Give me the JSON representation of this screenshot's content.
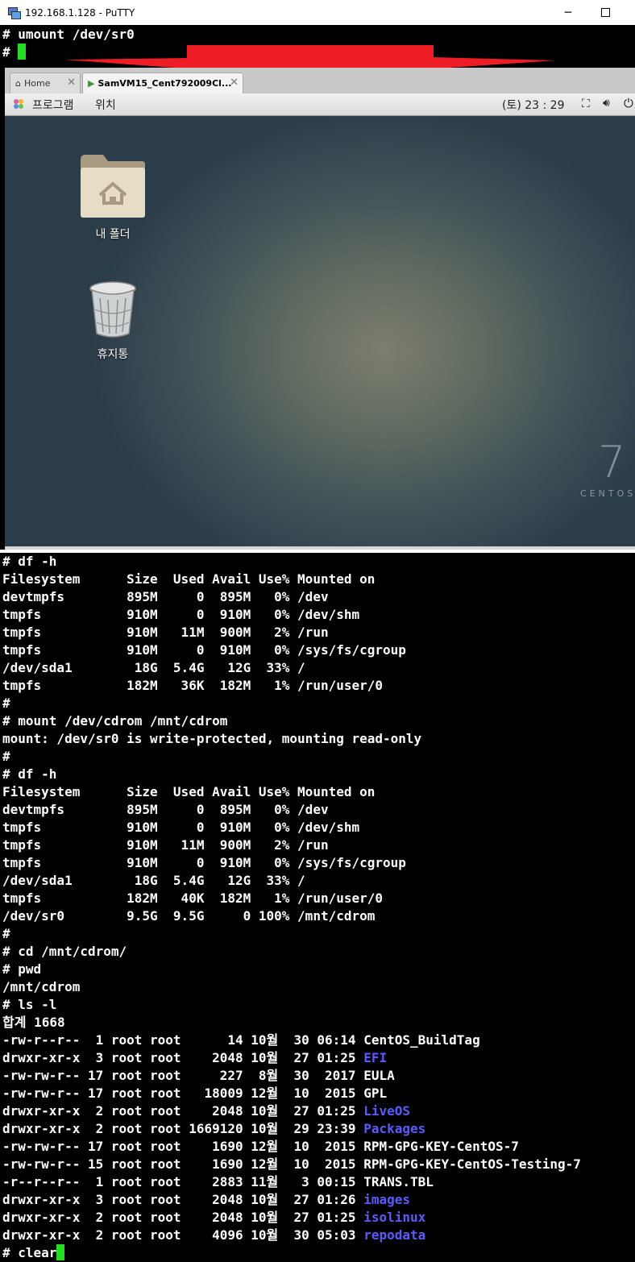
{
  "window": {
    "title": "192.168.1.128 - PuTTY",
    "minimize_glyph": "─"
  },
  "top_terminal": [
    {
      "text": "# umount /dev/sr0",
      "cursor": false
    },
    {
      "text": "# ",
      "cursor": true
    }
  ],
  "vm": {
    "tabs": [
      {
        "label": "Home",
        "icon": "home-icon",
        "active": false
      },
      {
        "label": "SamVM15_Cent792009Cl...",
        "icon": "vm-play-icon",
        "active": true
      }
    ],
    "close_glyph": "✕",
    "menu": {
      "applications": "프로그램",
      "places": "위치"
    },
    "clock": "(토) 23 : 29",
    "tray_icons": [
      "network-icon",
      "volume-icon",
      "power-icon"
    ],
    "desktop": {
      "icons": [
        {
          "label": "내 폴더",
          "icon": "home-folder-icon"
        },
        {
          "label": "휴지통",
          "icon": "trash-icon"
        }
      ],
      "watermark_number": "7",
      "watermark_text": "CENTOS"
    }
  },
  "bottom_terminal": [
    {
      "text": "# df -h"
    },
    {
      "text": "Filesystem      Size  Used Avail Use% Mounted on"
    },
    {
      "text": "devtmpfs        895M     0  895M   0% /dev"
    },
    {
      "text": "tmpfs           910M     0  910M   0% /dev/shm"
    },
    {
      "text": "tmpfs           910M   11M  900M   2% /run"
    },
    {
      "text": "tmpfs           910M     0  910M   0% /sys/fs/cgroup"
    },
    {
      "text": "/dev/sda1        18G  5.4G   12G  33% /"
    },
    {
      "text": "tmpfs           182M   36K  182M   1% /run/user/0"
    },
    {
      "text": "#"
    },
    {
      "text": "# mount /dev/cdrom /mnt/cdrom"
    },
    {
      "text": "mount: /dev/sr0 is write-protected, mounting read-only"
    },
    {
      "text": "#"
    },
    {
      "text": "# df -h"
    },
    {
      "text": "Filesystem      Size  Used Avail Use% Mounted on"
    },
    {
      "text": "devtmpfs        895M     0  895M   0% /dev"
    },
    {
      "text": "tmpfs           910M     0  910M   0% /dev/shm"
    },
    {
      "text": "tmpfs           910M   11M  900M   2% /run"
    },
    {
      "text": "tmpfs           910M     0  910M   0% /sys/fs/cgroup"
    },
    {
      "text": "/dev/sda1        18G  5.4G   12G  33% /"
    },
    {
      "text": "tmpfs           182M   40K  182M   1% /run/user/0"
    },
    {
      "text": "/dev/sr0        9.5G  9.5G     0 100% /mnt/cdrom"
    },
    {
      "text": "#"
    },
    {
      "text": "# cd /mnt/cdrom/"
    },
    {
      "text": "# pwd"
    },
    {
      "text": "/mnt/cdrom"
    },
    {
      "text": "# ls -l"
    },
    {
      "text": "합계 1668"
    },
    {
      "text": "-rw-r--r--  1 root root      14 10월  30 06:14 ",
      "name": "CentOS_BuildTag",
      "dir": false
    },
    {
      "text": "drwxr-xr-x  3 root root    2048 10월  27 01:25 ",
      "name": "EFI",
      "dir": true
    },
    {
      "text": "-rw-rw-r-- 17 root root     227  8월  30  2017 ",
      "name": "EULA",
      "dir": false
    },
    {
      "text": "-rw-rw-r-- 17 root root   18009 12월  10  2015 ",
      "name": "GPL",
      "dir": false
    },
    {
      "text": "drwxr-xr-x  2 root root    2048 10월  27 01:25 ",
      "name": "LiveOS",
      "dir": true
    },
    {
      "text": "drwxr-xr-x  2 root root 1669120 10월  29 23:39 ",
      "name": "Packages",
      "dir": true
    },
    {
      "text": "-rw-rw-r-- 17 root root    1690 12월  10  2015 ",
      "name": "RPM-GPG-KEY-CentOS-7",
      "dir": false
    },
    {
      "text": "-rw-rw-r-- 15 root root    1690 12월  10  2015 ",
      "name": "RPM-GPG-KEY-CentOS-Testing-7",
      "dir": false
    },
    {
      "text": "-r--r--r--  1 root root    2883 11월   3 00:15 ",
      "name": "TRANS.TBL",
      "dir": false
    },
    {
      "text": "drwxr-xr-x  3 root root    2048 10월  27 01:26 ",
      "name": "images",
      "dir": true
    },
    {
      "text": "drwxr-xr-x  2 root root    2048 10월  27 01:25 ",
      "name": "isolinux",
      "dir": true
    },
    {
      "text": "drwxr-xr-x  2 root root    4096 10월  30 05:03 ",
      "name": "repodata",
      "dir": true
    },
    {
      "text": "# clear",
      "cursor": true
    }
  ],
  "colors": {
    "dir": "#5a5aff",
    "cursor": "#20e020",
    "marker": "#ee1c25"
  }
}
